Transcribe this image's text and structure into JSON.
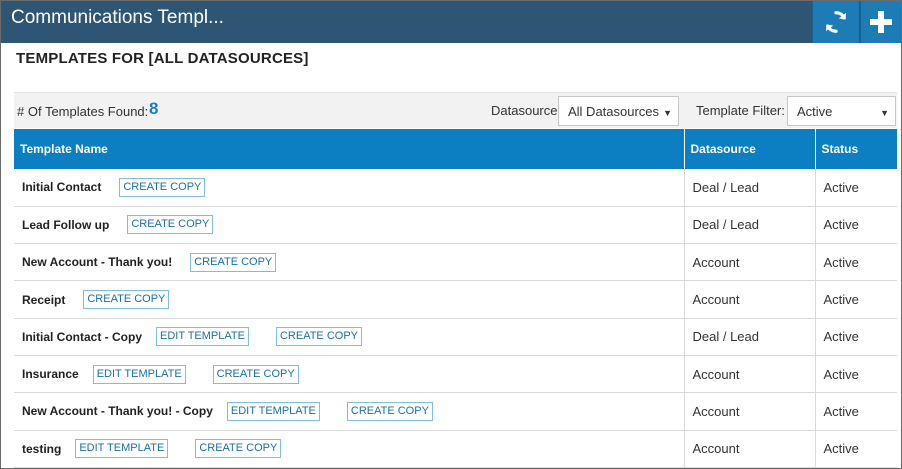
{
  "header": {
    "title": "Communications Templ...",
    "refresh_icon": "refresh-icon",
    "add_icon": "plus-icon"
  },
  "page": {
    "heading": "TEMPLATES FOR [ALL DATASOURCES]"
  },
  "filters": {
    "found_label": "# Of Templates Found:",
    "found_count": "8",
    "datasource_label": "Datasource:",
    "datasource_value": "All Datasources",
    "template_filter_label": "Template Filter:",
    "template_filter_value": "Active"
  },
  "table": {
    "columns": [
      "Template Name",
      "Datasource",
      "Status"
    ],
    "rows": [
      {
        "name": "Initial Contact",
        "edit": "",
        "copy": "CREATE COPY",
        "datasource": "Deal / Lead",
        "status": "Active"
      },
      {
        "name": "Lead Follow up",
        "edit": "",
        "copy": "CREATE COPY",
        "datasource": "Deal / Lead",
        "status": "Active"
      },
      {
        "name": "New Account - Thank you!",
        "edit": "",
        "copy": "CREATE COPY",
        "datasource": "Account",
        "status": "Active"
      },
      {
        "name": "Receipt",
        "edit": "",
        "copy": "CREATE COPY",
        "datasource": "Account",
        "status": "Active"
      },
      {
        "name": "Initial Contact - Copy",
        "edit": "EDIT TEMPLATE",
        "copy": "CREATE COPY",
        "datasource": "Deal / Lead",
        "status": "Active"
      },
      {
        "name": "Insurance",
        "edit": "EDIT TEMPLATE",
        "copy": "CREATE COPY",
        "datasource": "Account",
        "status": "Active"
      },
      {
        "name": "New Account - Thank you! - Copy",
        "edit": "EDIT TEMPLATE",
        "copy": "CREATE COPY",
        "datasource": "Account",
        "status": "Active"
      },
      {
        "name": "testing",
        "edit": "EDIT TEMPLATE",
        "copy": "CREATE COPY",
        "datasource": "Account",
        "status": "Active"
      }
    ]
  },
  "colors": {
    "topbar": "#2e5573",
    "topbar_button": "#1d7bb5",
    "table_header": "#0b7fc1",
    "accent": "#1c7fbf"
  }
}
